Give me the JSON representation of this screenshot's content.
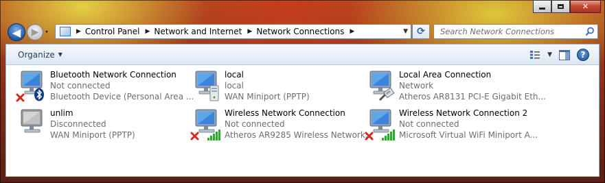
{
  "window": {
    "min_label": "",
    "max_label": "",
    "close_label": "✕"
  },
  "nav": {
    "back_glyph": "◀",
    "forward_glyph": "▶",
    "recent_glyph": "▾"
  },
  "address": {
    "crumbs": [
      "Control Panel",
      "Network and Internet",
      "Network Connections"
    ],
    "refresh_glyph": "⟳",
    "search_placeholder": "Search Network Connections"
  },
  "toolbar": {
    "organize_label": "Organize",
    "organize_arrow": "▼"
  },
  "connections": [
    {
      "name": "Bluetooth Network Connection",
      "status": "Not connected",
      "device": "Bluetooth Device (Personal Area ...",
      "badge": "bluetooth",
      "x_mark": true
    },
    {
      "name": "local",
      "status": "local",
      "device": "WAN Miniport (PPTP)",
      "badge": "server",
      "x_mark": false
    },
    {
      "name": "Local Area Connection",
      "status": "Network",
      "device": "Atheros AR8131 PCI-E Gigabit Eth...",
      "badge": "ethernet",
      "x_mark": false
    },
    {
      "name": "unlim",
      "status": "Disconnected",
      "device": "WAN Miniport (PPTP)",
      "badge": "gray-monitor",
      "x_mark": false
    },
    {
      "name": "Wireless Network Connection",
      "status": "Not connected",
      "device": "Atheros AR9285 Wireless Network...",
      "badge": "signal-bars",
      "x_mark": true
    },
    {
      "name": "Wireless Network Connection 2",
      "status": "Not connected",
      "device": "Microsoft Virtual WiFi Miniport A...",
      "badge": "signal-bars",
      "x_mark": true
    }
  ],
  "colors": {
    "status_gray": "#6d6d6d",
    "accent_blue": "#1e3a5f",
    "error_red": "#d42a1e",
    "signal_green": "#3aa23a"
  }
}
